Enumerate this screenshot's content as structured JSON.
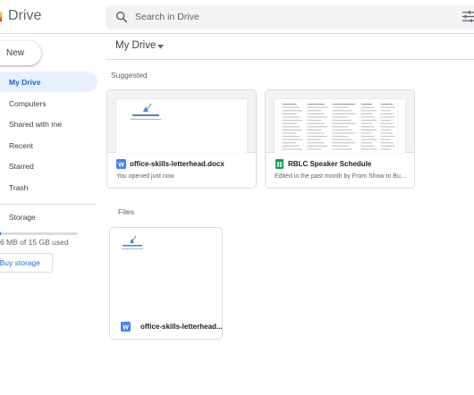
{
  "app": {
    "title": "Drive"
  },
  "search": {
    "placeholder": "Search in Drive"
  },
  "sidebar": {
    "new_label": "New",
    "items": [
      {
        "label": "My Drive",
        "active": true
      },
      {
        "label": "Computers"
      },
      {
        "label": "Shared with me"
      },
      {
        "label": "Recent"
      },
      {
        "label": "Starred"
      },
      {
        "label": "Trash"
      },
      {
        "label": "Storage"
      }
    ],
    "storage_text": "6 MB of 15 GB used",
    "buy_storage_label": "Buy storage"
  },
  "main": {
    "title": "My Drive",
    "suggested_label": "Suggested",
    "files_label": "Files",
    "suggested": [
      {
        "name": "office-skills-letterhead.docx",
        "subtitle": "You opened just now",
        "icon": "docs-icon"
      },
      {
        "name": "RBLC Speaker Schedule",
        "subtitle": "Edited in the past month by From Show to Bu...",
        "icon": "sheets-icon"
      }
    ],
    "files": [
      {
        "name": "office-skills-letterhead....",
        "icon": "docs-icon"
      }
    ]
  },
  "colors": {
    "accent": "#1a73e8",
    "active_bg": "#e8f0fe",
    "docs_blue": "#4285f4",
    "sheets_green": "#0f9d58",
    "border": "#dadce0"
  }
}
